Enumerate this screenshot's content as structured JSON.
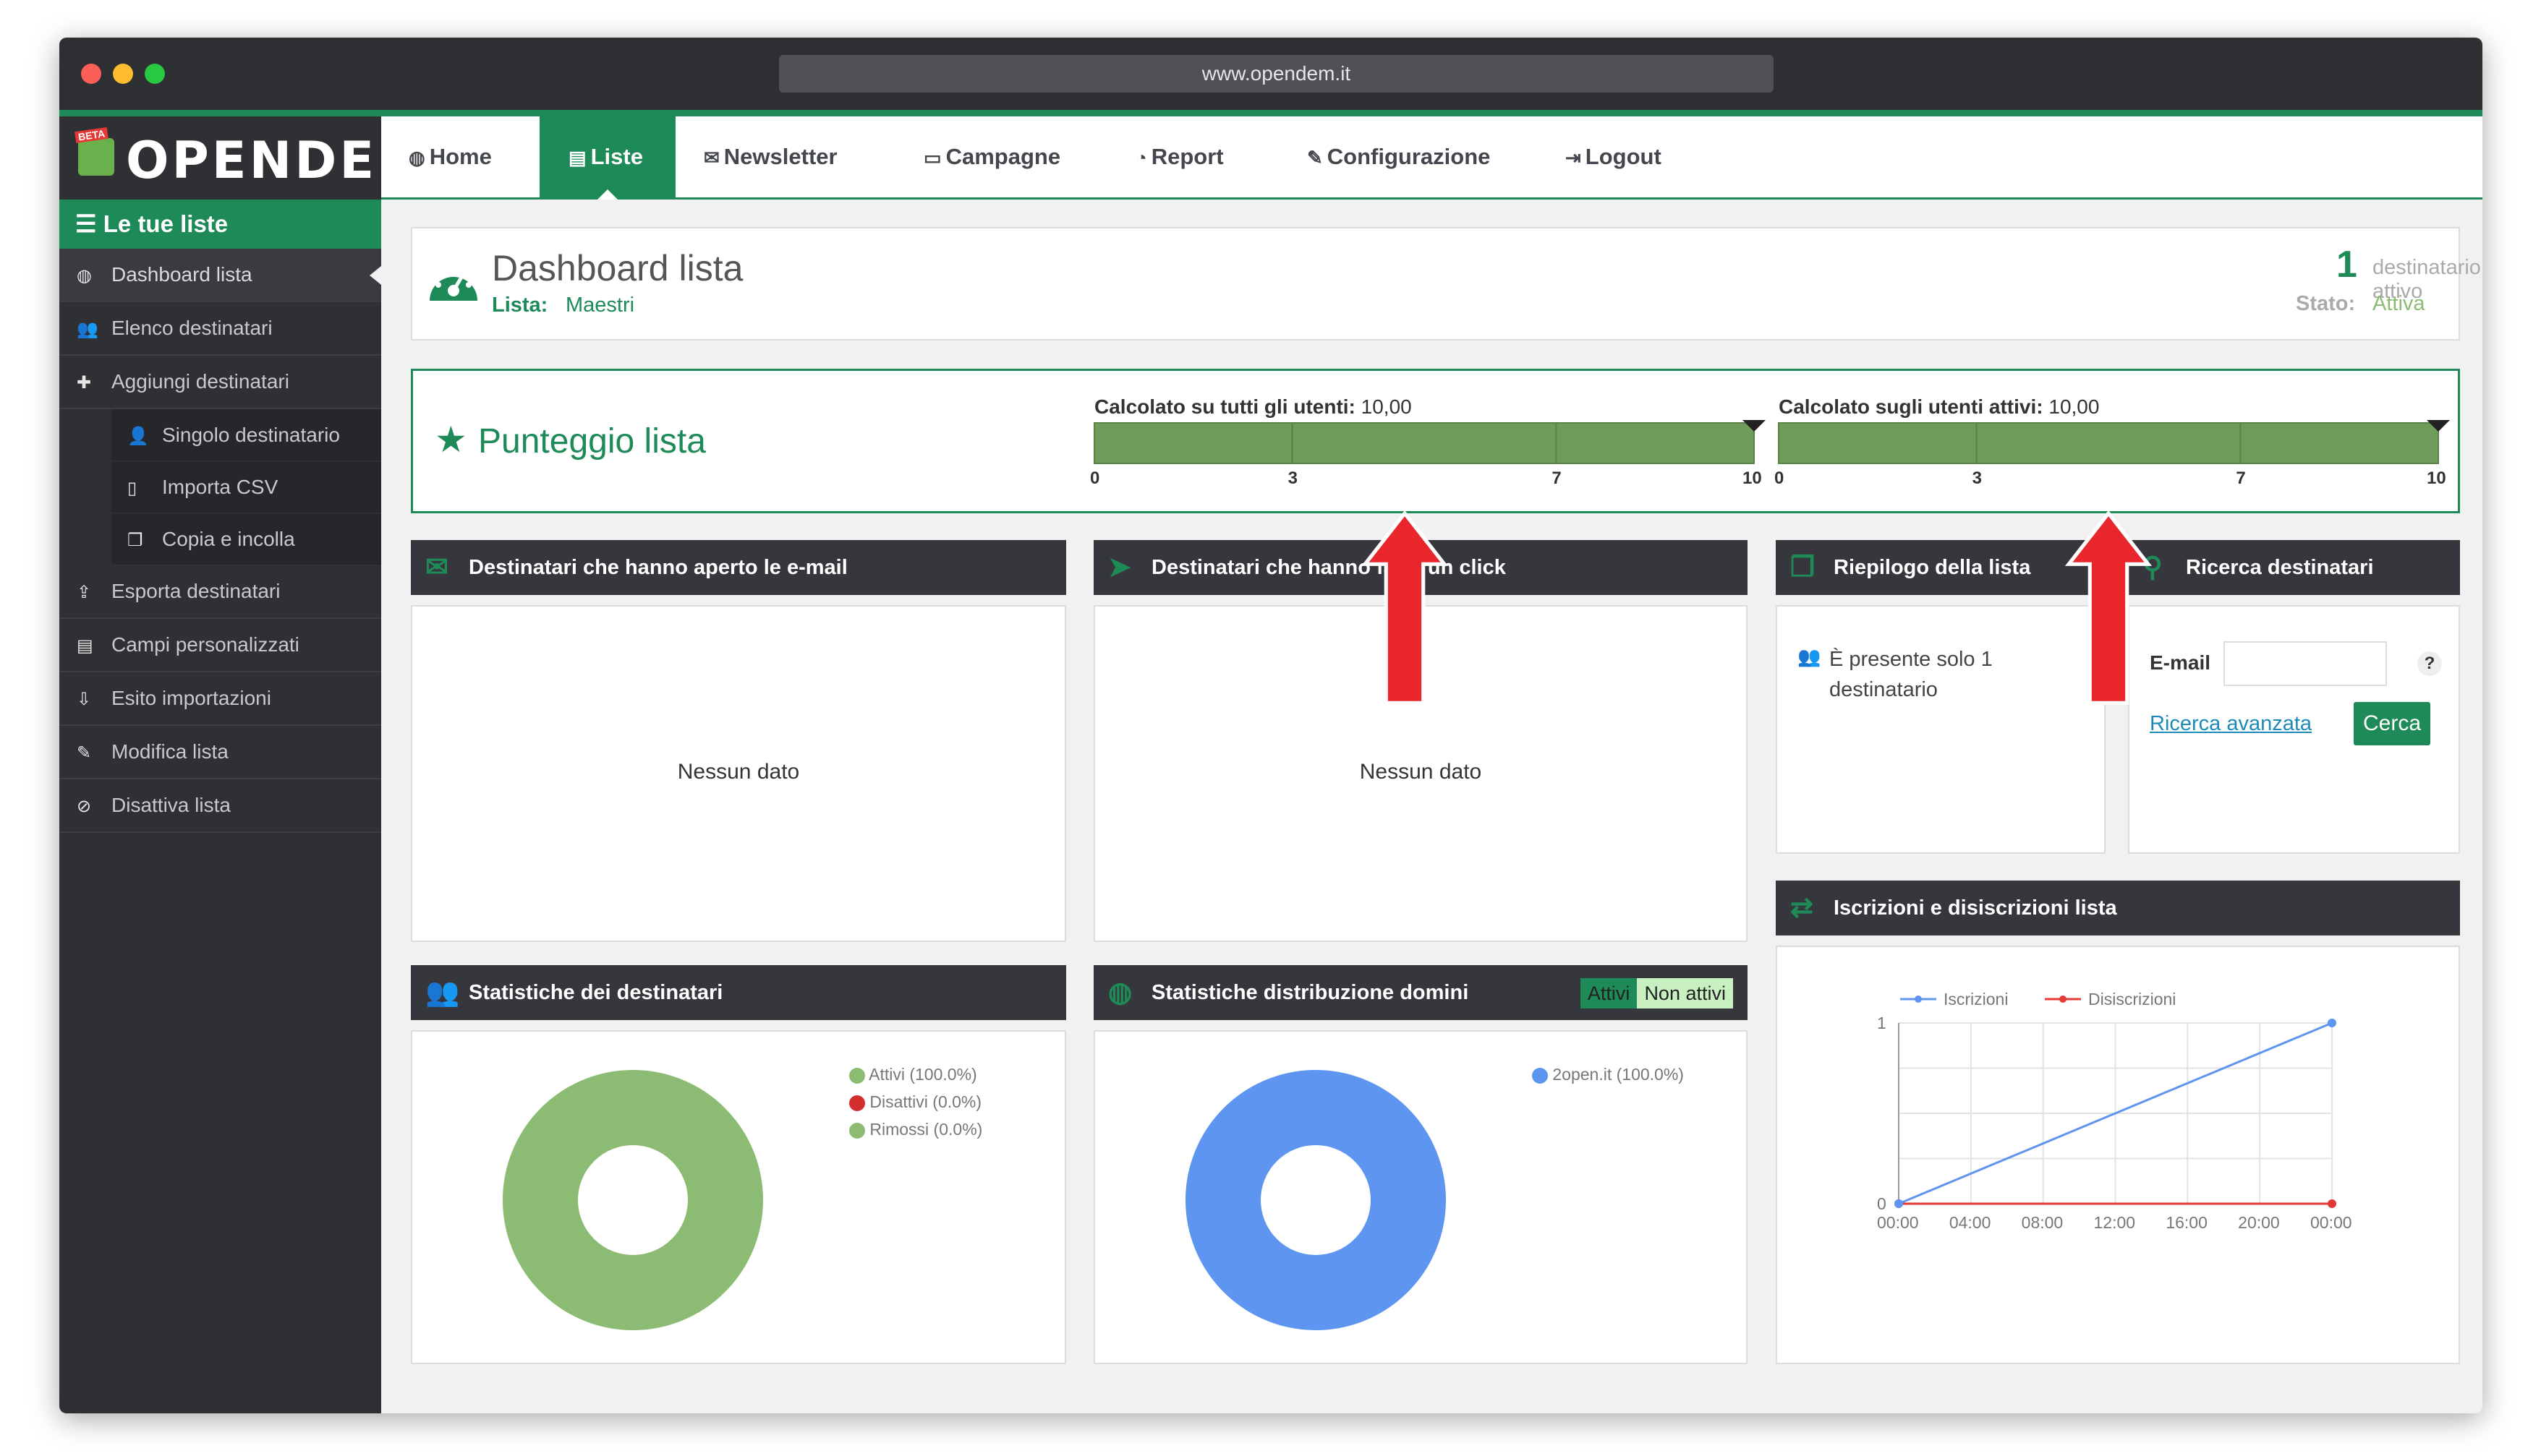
{
  "browser": {
    "url": "www.opendem.it"
  },
  "logo": {
    "text": "OPENDEM",
    "badge": "BETA"
  },
  "nav": {
    "items": [
      {
        "label": "Home",
        "icon": "dashboard-icon"
      },
      {
        "label": "Liste",
        "icon": "list-icon"
      },
      {
        "label": "Newsletter",
        "icon": "envelope-icon"
      },
      {
        "label": "Campagne",
        "icon": "folder-icon"
      },
      {
        "label": "Report",
        "icon": "pie-chart-icon"
      },
      {
        "label": "Configurazione",
        "icon": "wrench-icon"
      },
      {
        "label": "Logout",
        "icon": "logout-icon"
      }
    ],
    "active": "Liste"
  },
  "sidebar": {
    "title": "Le tue liste",
    "items": [
      {
        "label": "Dashboard lista"
      },
      {
        "label": "Elenco destinatari"
      },
      {
        "label": "Aggiungi destinatari"
      },
      {
        "label": "Singolo destinatario"
      },
      {
        "label": "Importa CSV"
      },
      {
        "label": "Copia e incolla"
      },
      {
        "label": "Esporta destinatari"
      },
      {
        "label": "Campi personalizzati"
      },
      {
        "label": "Esito importazioni"
      },
      {
        "label": "Modifica lista"
      },
      {
        "label": "Disattiva lista"
      }
    ]
  },
  "header": {
    "title": "Dashboard lista",
    "list_label": "Lista:",
    "list_name": "Maestri",
    "active_count": "1",
    "active_text": "destinatario attivo",
    "state_label": "Stato:",
    "state_value": "Attiva"
  },
  "score": {
    "title": "Punteggio lista",
    "all_label": "Calcolato su tutti gli utenti:",
    "all_value": "10,00",
    "active_label": "Calcolato sugli utenti attivi:",
    "active_value": "10,00",
    "ticks": [
      "0",
      "3",
      "7",
      "10"
    ],
    "score_all": 10,
    "score_active": 10
  },
  "panels": {
    "opened": {
      "title": "Destinatari che hanno aperto le e-mail",
      "empty": "Nessun dato"
    },
    "clicked": {
      "title": "Destinatari che hanno fatto un click",
      "empty": "Nessun dato"
    },
    "summary": {
      "title": "Riepilogo della lista",
      "text": "È presente solo 1 destinatario"
    },
    "search": {
      "title": "Ricerca destinatari",
      "email_label": "E-mail",
      "help": "?",
      "advanced": "Ricerca avanzata",
      "button": "Cerca"
    },
    "stats": {
      "title": "Statistiche dei destinatari",
      "legend": [
        {
          "label": "Attivi (100.0%)",
          "color": "#8cbc73"
        },
        {
          "label": "Disattivi (0.0%)",
          "color": "#d32f2f"
        },
        {
          "label": "Rimossi (0.0%)",
          "color": "#8cbc73"
        }
      ]
    },
    "domains": {
      "title": "Statistiche distribuzione domini",
      "toggle_active": "Attivi",
      "toggle_inactive": "Non attivi",
      "legend": [
        {
          "label": "2open.it (100.0%)",
          "color": "#5d95f0"
        }
      ]
    },
    "subscriptions": {
      "title": "Iscrizioni e disiscrizioni lista"
    }
  },
  "chart_data": [
    {
      "type": "pie",
      "title": "Statistiche dei destinatari",
      "categories": [
        "Attivi",
        "Disattivi",
        "Rimossi"
      ],
      "values": [
        100.0,
        0.0,
        0.0
      ]
    },
    {
      "type": "pie",
      "title": "Statistiche distribuzione domini",
      "categories": [
        "2open.it"
      ],
      "values": [
        100.0
      ]
    },
    {
      "type": "line",
      "title": "Iscrizioni e disiscrizioni lista",
      "x": [
        "00:00",
        "04:00",
        "08:00",
        "12:00",
        "16:00",
        "20:00",
        "00:00"
      ],
      "series": [
        {
          "name": "Iscrizioni",
          "color": "#5d95f0",
          "start": 0,
          "end": 1
        },
        {
          "name": "Disiscrizioni",
          "color": "#e53935",
          "start": 0,
          "end": 0
        }
      ],
      "ylim": [
        0,
        1
      ],
      "yticks": [
        "0",
        "1"
      ],
      "grid": true,
      "legend": "top"
    }
  ],
  "colors": {
    "brand": "#1e8a57",
    "dark": "#36373c",
    "bar": "#6f9c5a"
  }
}
